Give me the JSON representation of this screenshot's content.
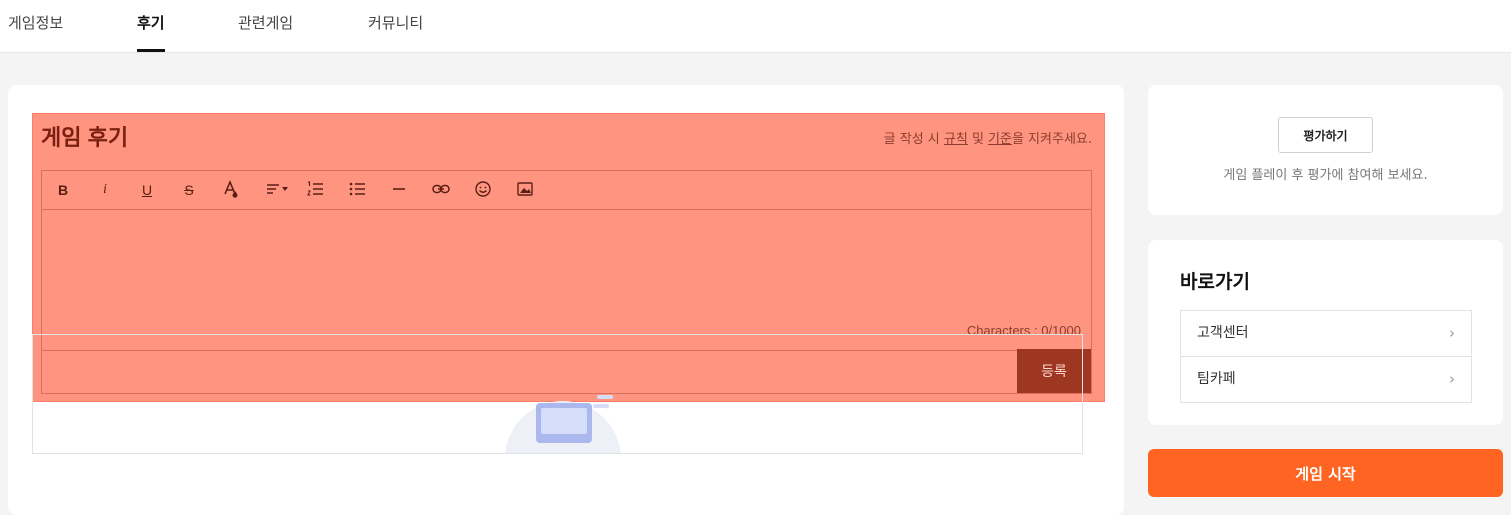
{
  "nav": {
    "tabs": [
      {
        "label": "게임정보"
      },
      {
        "label": "후기"
      },
      {
        "label": "관련게임"
      },
      {
        "label": "커뮤니티"
      }
    ]
  },
  "review": {
    "title": "게임 후기",
    "guide_prefix": "글 작성 시 ",
    "guide_rules": "규칙",
    "guide_and": " 및 ",
    "guide_standard": "기준",
    "guide_suffix": "을 지켜주세요.",
    "toolbar": {
      "bold": "B",
      "italic": "i",
      "underline": "U",
      "strike": "S"
    },
    "char_count": "Characters : 0/1000",
    "submit_label": "등록"
  },
  "rating": {
    "button_label": "평가하기",
    "description": "게임 플레이 후 평가에 참여해 보세요."
  },
  "shortcuts": {
    "title": "바로가기",
    "items": [
      {
        "label": "고객센터"
      },
      {
        "label": "팀카페"
      }
    ]
  },
  "start_button_label": "게임 시작",
  "colors": {
    "accent": "#ff6422",
    "highlight": "#ff9480",
    "submit": "#9e3722"
  }
}
